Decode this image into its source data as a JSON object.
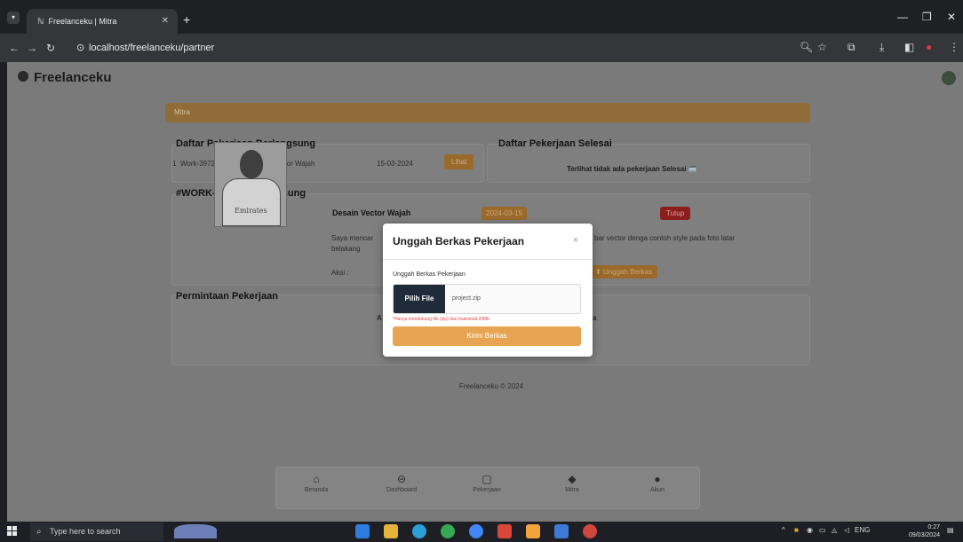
{
  "browser": {
    "tab_title": "Freelanceku | Mitra",
    "tab_favicon": "ℕ",
    "url": "localhost/freelanceku/partner"
  },
  "app": {
    "brand": "Freelanceku",
    "banner": "Mitra"
  },
  "ongoing": {
    "title": "Daftar Pekerjaan Berlangsung",
    "row_no": "1",
    "row_code": "Work-3972",
    "row_name": "Desain Vector Wajah",
    "row_date": "15-03-2024",
    "row_button": "Lihat"
  },
  "finished": {
    "title": "Daftar Pekerjaan Selesai",
    "empty": "Terlihat tidak ada pekerjaan Selesai 🥽"
  },
  "detail": {
    "title": "#WORK-3972 - Berlangsung",
    "job_name": "Desain Vector Wajah",
    "date_tag": "2024-03-15",
    "close_button": "Tutup",
    "desc_left": "Saya mencar",
    "desc_left2": "belakang",
    "desc_right": "bar vector denga contoh style pada foto latar",
    "action_label": "Aksi :",
    "upload_button": "Unggah Berkas",
    "photo_caption": "Emirates"
  },
  "requests": {
    "title": "Permintaan Pekerjaan",
    "fragment_left": "A",
    "fragment_right": "a"
  },
  "footer": "Freelanceku © 2024",
  "bottom_nav": [
    {
      "label": "Beranda",
      "icon": "home-icon",
      "glyph": "⌂"
    },
    {
      "label": "Dashboard",
      "icon": "dashboard-icon",
      "glyph": "⊖"
    },
    {
      "label": "Pekerjaan",
      "icon": "briefcase-icon",
      "glyph": "▢"
    },
    {
      "label": "Mitra",
      "icon": "handshake-icon",
      "glyph": "◆"
    },
    {
      "label": "Akun",
      "icon": "account-icon",
      "glyph": "●"
    }
  ],
  "modal": {
    "title": "Unggah Berkas Pekerjaan",
    "close": "×",
    "field_label": "Unggah Berkas Pekerjaan",
    "file_button": "Pilih File",
    "file_name": "project.zip",
    "hint": "*Hanya mendukung file (zip) dan maksimal 20Mb",
    "submit": "Kirim Berkas"
  },
  "taskbar": {
    "search_placeholder": "Type here to search",
    "lang": "ENG",
    "time": "0:27",
    "date": "09/03/2024"
  },
  "colors": {
    "accent": "#e7a553",
    "danger": "#d62f2f",
    "brand_dark": "#1f2b38"
  }
}
